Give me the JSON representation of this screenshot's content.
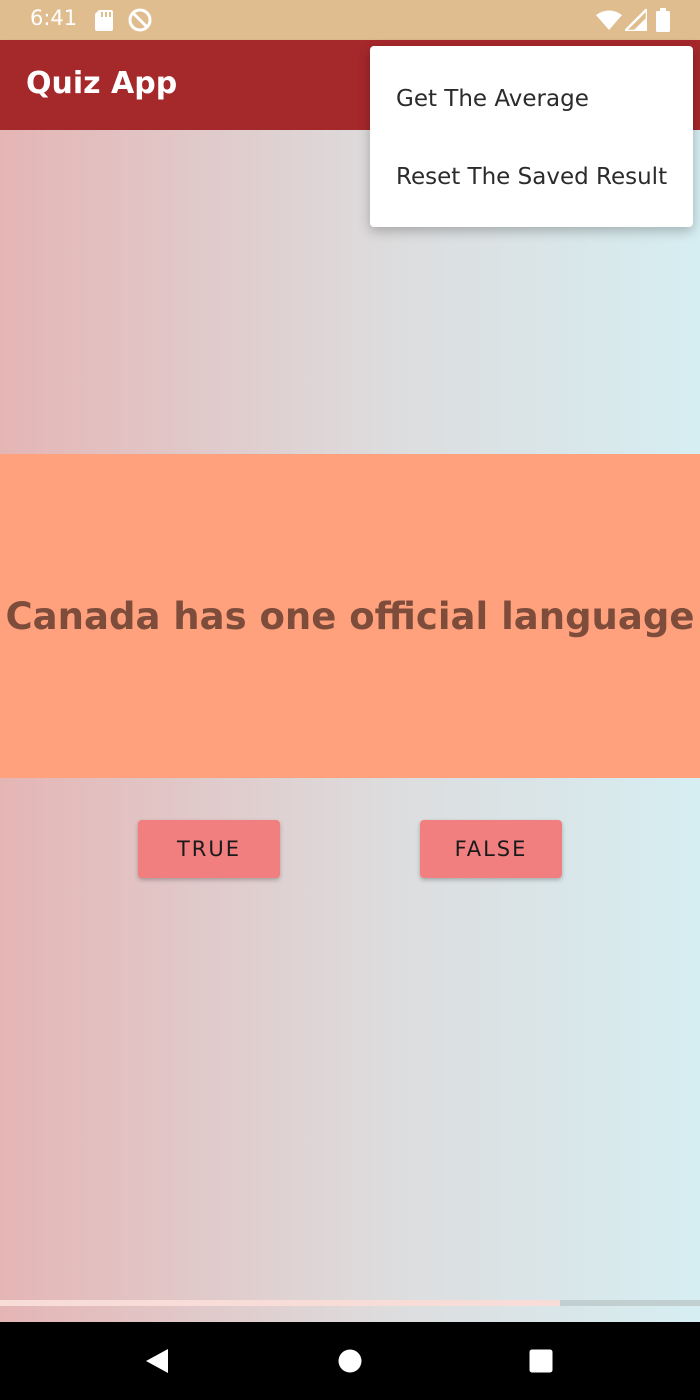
{
  "status_bar": {
    "time": "6:41",
    "icons": [
      "sd-card-icon",
      "do-not-disturb-icon",
      "wifi-icon",
      "signal-icon",
      "battery-icon"
    ]
  },
  "app_bar": {
    "title": "Quiz App"
  },
  "overflow_menu": {
    "items": [
      {
        "label": "Get The Average"
      },
      {
        "label": "Reset The Saved Result"
      }
    ]
  },
  "question": {
    "text": "Canada has one official language"
  },
  "buttons": {
    "true_label": "TRUE",
    "false_label": "FALSE"
  },
  "progress": {
    "fraction": 0.8
  },
  "nav_bar": {
    "icons": [
      "back-icon",
      "home-icon",
      "recents-icon"
    ]
  },
  "colors": {
    "status_bar": "#e0bd8f",
    "app_bar": "#a5282b",
    "question_panel": "#ffa17c",
    "question_text": "#7d4c3b",
    "button": "#f17f80"
  }
}
